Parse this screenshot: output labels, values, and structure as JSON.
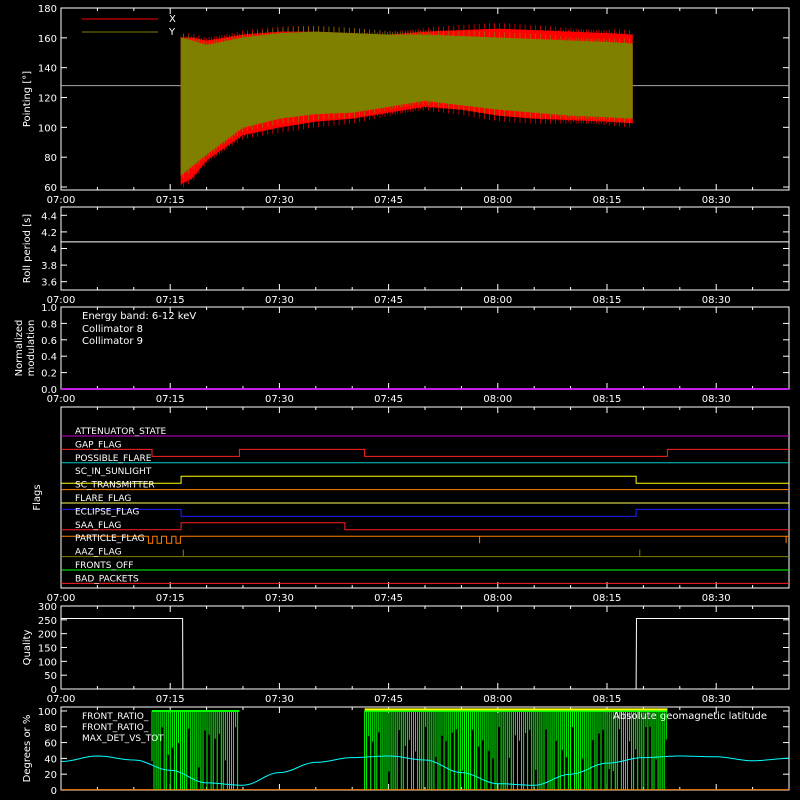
{
  "chart_data": [
    {
      "type": "line",
      "panel": "pointing",
      "ylabel": "Pointing [°]",
      "ylim": [
        58,
        180
      ],
      "yticks": [
        60,
        80,
        100,
        120,
        140,
        160,
        180
      ],
      "xlim_minutes": [
        0,
        100
      ],
      "xtick_labels": [
        "07:00",
        "07:15",
        "07:30",
        "07:45",
        "08:00",
        "08:15",
        "08:30"
      ],
      "reference_line": 128,
      "series": [
        {
          "name": "X",
          "color": "#ff0000",
          "x": [
            16.5,
            18,
            20,
            25,
            30,
            35,
            40,
            45,
            50,
            55,
            60,
            65,
            70,
            75,
            78.5
          ],
          "upper": [
            160,
            160,
            158,
            162,
            164,
            164,
            163,
            162,
            164,
            165,
            166,
            165,
            164,
            163,
            162
          ],
          "lower": [
            62,
            66,
            78,
            95,
            100,
            104,
            106,
            110,
            114,
            112,
            108,
            106,
            105,
            104,
            103
          ]
        },
        {
          "name": "Y",
          "color": "#808000",
          "x": [
            16.5,
            18,
            20,
            25,
            30,
            35,
            40,
            45,
            50,
            55,
            60,
            65,
            70,
            75,
            78.5
          ],
          "upper": [
            160,
            158,
            155,
            160,
            163,
            164,
            163,
            162,
            162,
            161,
            160,
            159,
            158,
            157,
            156
          ],
          "lower": [
            68,
            74,
            82,
            100,
            106,
            109,
            110,
            114,
            118,
            115,
            112,
            110,
            108,
            107,
            106
          ]
        }
      ]
    },
    {
      "type": "line",
      "panel": "roll",
      "ylabel": "Roll period [s]",
      "ylim": [
        3.5,
        4.5
      ],
      "yticks": [
        3.6,
        3.8,
        4.0,
        4.2,
        4.4
      ],
      "series": [
        {
          "color": "#ffffff",
          "x": [
            0,
            100
          ],
          "y": [
            4.08,
            4.08
          ]
        }
      ]
    },
    {
      "type": "line",
      "panel": "modulation",
      "ylabel": "Normalized modulation",
      "ylim": [
        0,
        1
      ],
      "yticks": [
        "0.0",
        "0.2",
        "0.4",
        "0.6",
        "0.8",
        "1.0"
      ],
      "annotation": "Energy band: 6-12 keV",
      "series": [
        {
          "name": "Collimator 8",
          "color": "#00ffff",
          "x": [
            0,
            100
          ],
          "y": [
            0,
            0
          ]
        },
        {
          "name": "Collimator 9",
          "color": "#ff00ff",
          "x": [
            0,
            100
          ],
          "y": [
            0,
            0
          ]
        }
      ]
    },
    {
      "type": "line",
      "panel": "flags",
      "ylabel": "Flags",
      "series": [
        {
          "name": "ATTENUATOR_STATE",
          "color": "#cc00cc",
          "steps": [
            [
              0,
              0
            ]
          ]
        },
        {
          "name": "GAP_FLAG",
          "color": "#ff2020",
          "steps": [
            [
              0,
              0
            ],
            [
              12.5,
              -1
            ],
            [
              24.5,
              0
            ],
            [
              41.7,
              -1
            ],
            [
              83.3,
              0
            ]
          ]
        },
        {
          "name": "POSSIBLE_FLARE",
          "color": "#00cccc",
          "steps": [
            [
              0,
              0
            ]
          ]
        },
        {
          "name": "SC_IN_SUNLIGHT",
          "color": "#ffff00",
          "steps": [
            [
              0,
              -1
            ],
            [
              16.5,
              0
            ],
            [
              79,
              -1
            ]
          ]
        },
        {
          "name": "SC_TRANSMITTER",
          "color": "#ff7f00",
          "steps": [
            [
              0,
              0
            ]
          ]
        },
        {
          "name": "FLARE_FLAG",
          "color": "#ffff50",
          "steps": [
            [
              0,
              0
            ]
          ]
        },
        {
          "name": "ECLIPSE_FLAG",
          "color": "#2020ff",
          "steps": [
            [
              0,
              1
            ],
            [
              16.5,
              0
            ],
            [
              79,
              1
            ]
          ]
        },
        {
          "name": "SAA_FLAG",
          "color": "#ff2020",
          "steps": [
            [
              0,
              0
            ],
            [
              16.5,
              1
            ],
            [
              39,
              0
            ]
          ]
        },
        {
          "name": "PARTICLE_FLAG",
          "color": "#ff7f00",
          "steps": [
            [
              0,
              1
            ],
            [
              12,
              0
            ],
            [
              12.6,
              1
            ],
            [
              13.2,
              0
            ],
            [
              13.8,
              1
            ],
            [
              14.5,
              0
            ],
            [
              15.2,
              1
            ],
            [
              15.8,
              0
            ],
            [
              16.4,
              1
            ]
          ],
          "spikes": [
            57.5,
            99.6
          ]
        },
        {
          "name": "AAZ_FLAG",
          "color": "#808000",
          "steps": [
            [
              0,
              0
            ]
          ],
          "spikes": [
            16.8,
            79.5
          ]
        },
        {
          "name": "FRONTS_OFF",
          "color": "#00ff00",
          "steps": [
            [
              0,
              0
            ]
          ]
        },
        {
          "name": "BAD_PACKETS",
          "color": "#ff2020",
          "steps": [
            [
              0,
              0
            ]
          ]
        }
      ]
    },
    {
      "type": "line",
      "panel": "quality",
      "ylabel": "Quality",
      "ylim": [
        0,
        300
      ],
      "yticks": [
        0,
        50,
        100,
        150,
        200,
        250,
        300
      ],
      "series": [
        {
          "color": "#ffffff",
          "x": [
            0,
            16.7,
            16.75,
            79,
            79.05,
            100
          ],
          "y": [
            255,
            255,
            0,
            0,
            255,
            255
          ]
        }
      ]
    },
    {
      "type": "line",
      "panel": "ratios",
      "ylabel": "Degrees or %",
      "ylim": [
        0,
        105
      ],
      "yticks": [
        0,
        20,
        40,
        60,
        80,
        100
      ],
      "legend": [
        "FRONT_RATIO_",
        "FRONT_RATIO_",
        "MAX_DET_VS_TOT"
      ],
      "right_label": "Absolute geomagnetic latitude",
      "green_bursts": [
        [
          12.5,
          24.5
        ],
        [
          41.7,
          83.3
        ]
      ],
      "series": [
        {
          "name": "FRONT_RATIO_",
          "color": "#ffff00",
          "x": [
            41.7,
            83.3
          ],
          "y": [
            102,
            102
          ]
        },
        {
          "name": "FRONT_RATIO_",
          "color": "#00ff00"
        },
        {
          "name": "MAX_DET_VS_TOT",
          "color": "#ff7f00",
          "x": [
            0,
            100
          ],
          "y": [
            0.5,
            0.5
          ]
        },
        {
          "name": "Absolute geomagnetic latitude",
          "color": "#00ffff",
          "x": [
            0,
            5,
            10,
            15,
            20,
            25,
            30,
            35,
            40,
            45,
            50,
            55,
            60,
            65,
            70,
            75,
            80,
            85,
            90,
            95,
            100
          ],
          "y": [
            36,
            43,
            38,
            25,
            9,
            6,
            22,
            35,
            41,
            43,
            38,
            22,
            8,
            6,
            20,
            34,
            41,
            43,
            42,
            37,
            40
          ]
        }
      ]
    }
  ]
}
